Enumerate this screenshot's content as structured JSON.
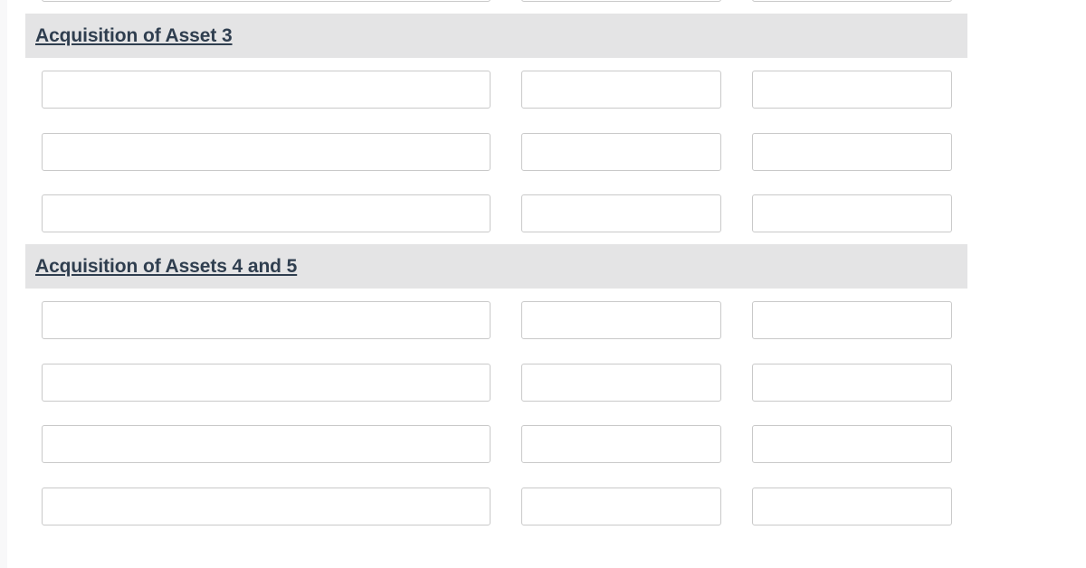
{
  "page": {
    "background_color": "#ffffff",
    "edge_strip_color": "#f8f8f9",
    "band_color": "#e4e4e5",
    "heading_color": "#2f3e4f",
    "field_border_color": "#c9c9c9"
  },
  "clipped_top_row": {
    "name": "partial-field-row",
    "fields": [
      {
        "value": "",
        "placeholder": ""
      },
      {
        "value": "",
        "placeholder": ""
      },
      {
        "value": "",
        "placeholder": ""
      }
    ]
  },
  "sections": [
    {
      "heading": "Acquisition of Asset 3",
      "rows": [
        {
          "fields": [
            {
              "value": "",
              "placeholder": ""
            },
            {
              "value": "",
              "placeholder": ""
            },
            {
              "value": "",
              "placeholder": ""
            }
          ]
        },
        {
          "fields": [
            {
              "value": "",
              "placeholder": ""
            },
            {
              "value": "",
              "placeholder": ""
            },
            {
              "value": "",
              "placeholder": ""
            }
          ]
        },
        {
          "fields": [
            {
              "value": "",
              "placeholder": ""
            },
            {
              "value": "",
              "placeholder": ""
            },
            {
              "value": "",
              "placeholder": ""
            }
          ]
        }
      ]
    },
    {
      "heading": "Acquisition of Assets 4 and 5",
      "rows": [
        {
          "fields": [
            {
              "value": "",
              "placeholder": ""
            },
            {
              "value": "",
              "placeholder": ""
            },
            {
              "value": "",
              "placeholder": ""
            }
          ]
        },
        {
          "fields": [
            {
              "value": "",
              "placeholder": ""
            },
            {
              "value": "",
              "placeholder": ""
            },
            {
              "value": "",
              "placeholder": ""
            }
          ]
        },
        {
          "fields": [
            {
              "value": "",
              "placeholder": ""
            },
            {
              "value": "",
              "placeholder": ""
            },
            {
              "value": "",
              "placeholder": ""
            }
          ]
        },
        {
          "fields": [
            {
              "value": "",
              "placeholder": ""
            },
            {
              "value": "",
              "placeholder": ""
            },
            {
              "value": "",
              "placeholder": ""
            }
          ]
        }
      ]
    }
  ]
}
